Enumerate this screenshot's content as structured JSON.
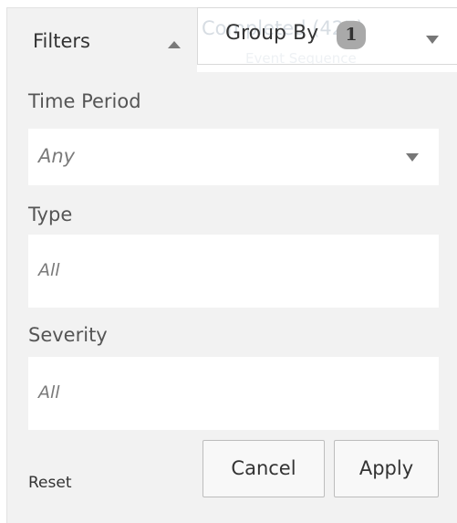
{
  "tabs": {
    "filters_label": "Filters",
    "group_by_label": "Group By",
    "group_by_count": "1",
    "behind_text": "Completed (427)",
    "behind_text_2": "Event Sequence"
  },
  "filters": {
    "time_period": {
      "label": "Time Period",
      "value": "Any"
    },
    "type": {
      "label": "Type",
      "value": "All"
    },
    "severity": {
      "label": "Severity",
      "value": "All"
    }
  },
  "actions": {
    "reset_label": "Reset",
    "cancel_label": "Cancel",
    "apply_label": "Apply"
  },
  "colors": {
    "panel_background": "#f2f2f2",
    "badge_background": "#a9a9a9"
  }
}
